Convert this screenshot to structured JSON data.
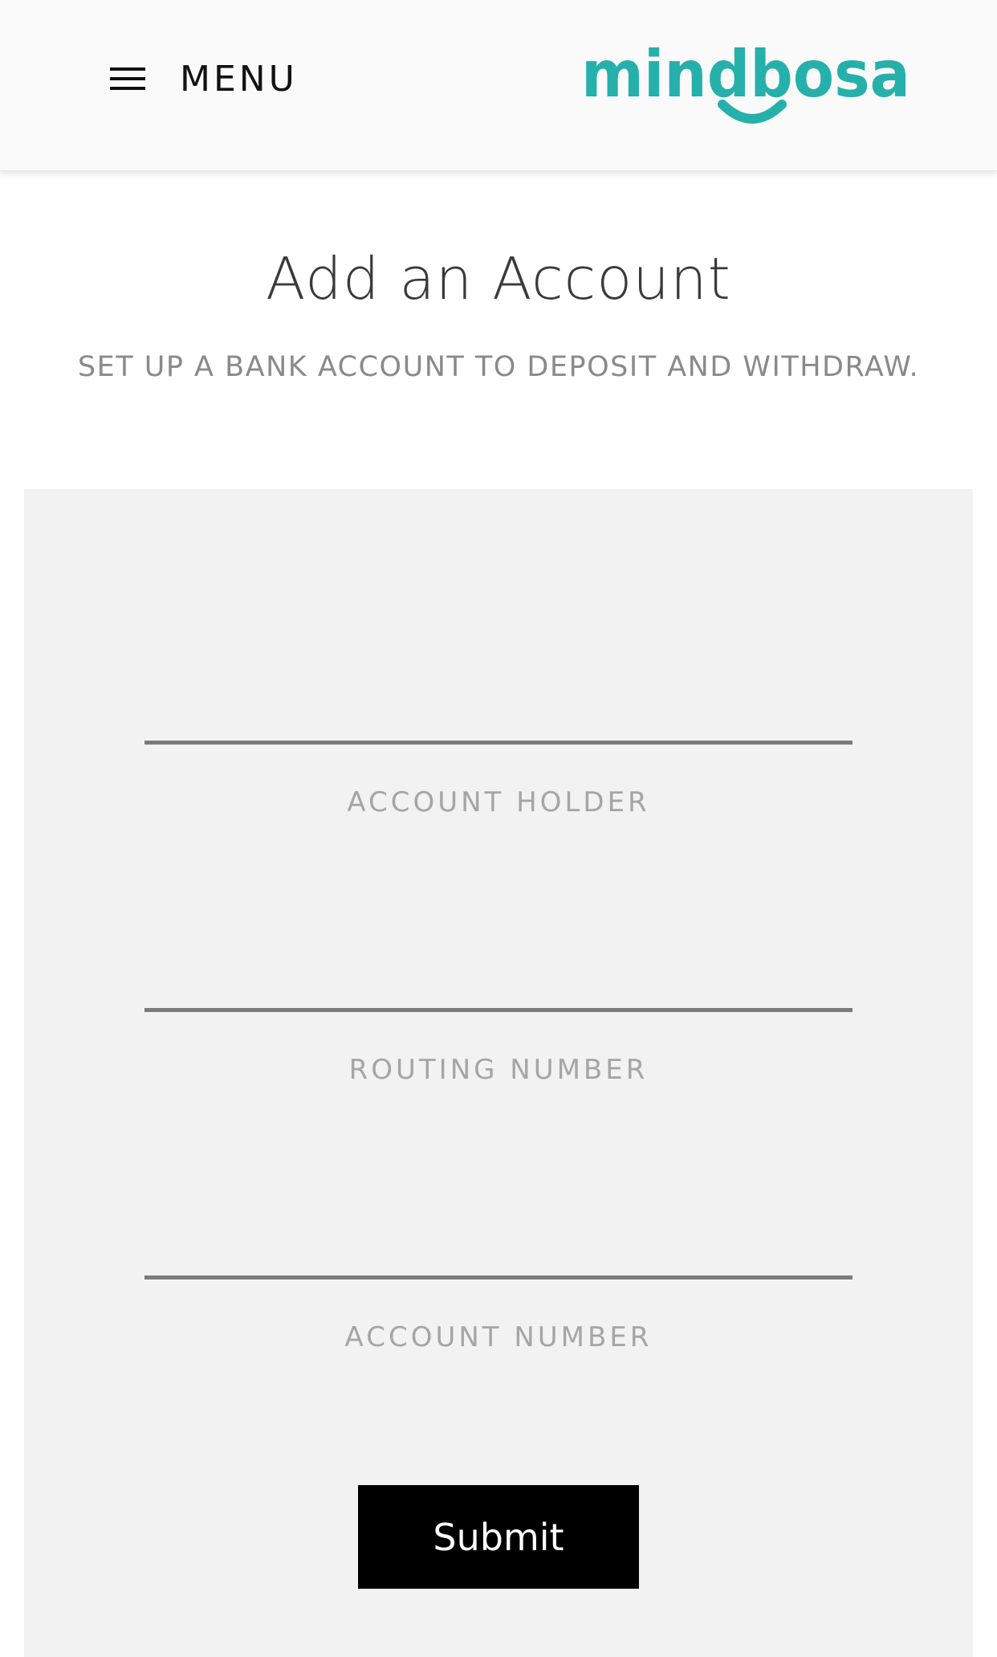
{
  "header": {
    "menu_label": "MENU",
    "menu_icon": "hamburger-icon",
    "logo_text": "mindbosa",
    "brand_color": "#26b0ab"
  },
  "main": {
    "title": "Add an Account",
    "subtitle": "SET UP A BANK ACCOUNT TO DEPOSIT AND WITHDRAW."
  },
  "form": {
    "fields": [
      {
        "label": "ACCOUNT HOLDER",
        "value": "",
        "placeholder": ""
      },
      {
        "label": "ROUTING NUMBER",
        "value": "",
        "placeholder": ""
      },
      {
        "label": "ACCOUNT NUMBER",
        "value": "",
        "placeholder": ""
      }
    ],
    "submit_label": "Submit"
  },
  "colors": {
    "header_bg": "#fafafa",
    "panel_bg": "#f2f2f2",
    "button_bg": "#000000",
    "label_color": "#a5a5a5"
  }
}
